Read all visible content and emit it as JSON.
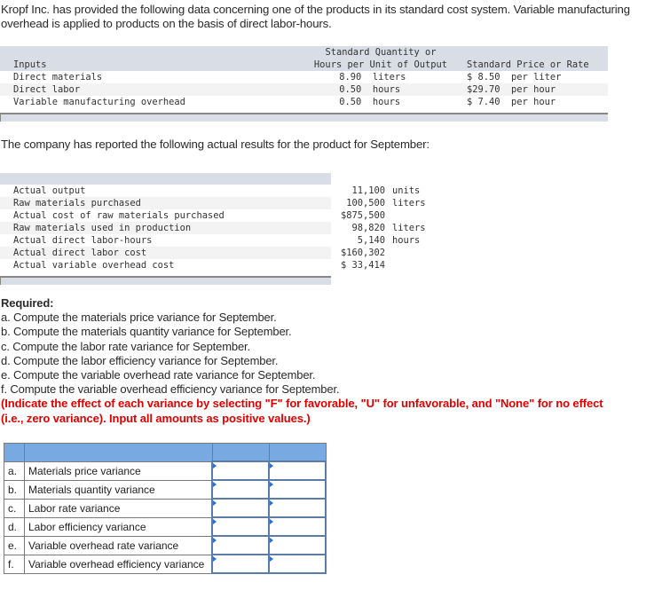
{
  "intro": "Kropf Inc. has provided the following data concerning one of the products in its standard cost system. Variable manufacturing overhead is applied to products on the basis of direct labor-hours.",
  "standards_table": {
    "header": {
      "col1": "Inputs",
      "col2_line1": "Standard Quantity or",
      "col2_line2": "Hours per Unit of Output",
      "col3": "Standard Price or Rate"
    },
    "rows": [
      {
        "input": "Direct materials",
        "quantity": "     8.90  liters",
        "price": "$ 8.50  per liter"
      },
      {
        "input": "Direct labor",
        "quantity": "     0.50  hours",
        "price": "$29.70  per hour"
      },
      {
        "input": "Variable manufacturing overhead",
        "quantity": "     0.50  hours",
        "price": "$ 7.40  per hour"
      }
    ]
  },
  "actuals_intro": "The company has reported the following actual results for the product for September:",
  "actuals_table": {
    "rows": [
      {
        "label": "Actual output",
        "value": "11,100",
        "unit": "units"
      },
      {
        "label": "Raw materials purchased",
        "value": "100,500",
        "unit": "liters"
      },
      {
        "label": "Actual cost of raw materials purchased",
        "value": "$875,500",
        "unit": ""
      },
      {
        "label": "Raw materials used in production",
        "value": "98,820",
        "unit": "liters"
      },
      {
        "label": "Actual direct labor-hours",
        "value": "5,140",
        "unit": "hours"
      },
      {
        "label": "Actual direct labor cost",
        "value": "$160,302",
        "unit": ""
      },
      {
        "label": "Actual variable overhead cost",
        "value": "$ 33,414",
        "unit": ""
      }
    ]
  },
  "required": {
    "title": "Required:",
    "items": [
      "a. Compute the materials price variance for September.",
      "b. Compute the materials quantity variance for September.",
      "c. Compute the labor rate variance for September.",
      "d. Compute the labor efficiency variance for September.",
      "e. Compute the variable overhead rate variance for September.",
      "f. Compute the variable overhead efficiency variance for September."
    ],
    "instruction_line1": "(Indicate the effect of each variance by selecting \"F\" for favorable, \"U\" for unfavorable, and \"None\" for no effect",
    "instruction_line2": "(i.e., zero variance). Input all amounts as positive values.)"
  },
  "answer_table": {
    "rows": [
      {
        "letter": "a.",
        "label": "Materials price variance",
        "amount": "",
        "effect": ""
      },
      {
        "letter": "b.",
        "label": "Materials quantity variance",
        "amount": "",
        "effect": ""
      },
      {
        "letter": "c.",
        "label": "Labor rate variance",
        "amount": "",
        "effect": ""
      },
      {
        "letter": "d.",
        "label": "Labor efficiency variance",
        "amount": "",
        "effect": ""
      },
      {
        "letter": "e.",
        "label": "Variable overhead rate variance",
        "amount": "",
        "effect": ""
      },
      {
        "letter": "f.",
        "label": "Variable overhead efficiency variance",
        "amount": "",
        "effect": ""
      }
    ]
  },
  "colors": {
    "table_header_gray": "#d9dde6",
    "answer_header_blue": "#78a9e0",
    "instruction_red": "#e00000",
    "input_border": "#5a7ca6"
  }
}
